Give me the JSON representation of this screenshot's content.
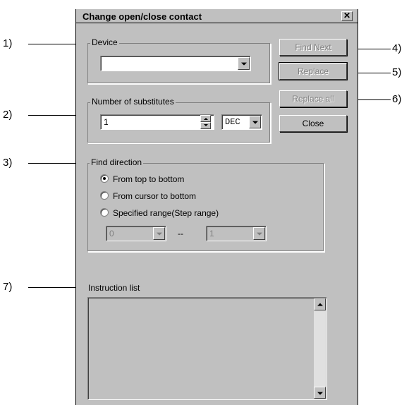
{
  "window": {
    "title": "Change open/close contact",
    "close_glyph": "✕"
  },
  "device": {
    "label": "Device",
    "value": ""
  },
  "substitutes": {
    "label": "Number of substitutes",
    "value": "1",
    "radix": "DEC"
  },
  "find_direction": {
    "label": "Find direction",
    "options": [
      {
        "label": "From top to bottom",
        "selected": true
      },
      {
        "label": "From cursor to bottom",
        "selected": false
      },
      {
        "label": "Specified range(Step range)",
        "selected": false
      }
    ],
    "range_from": "0",
    "range_sep": "--",
    "range_to": "1"
  },
  "instruction_list": {
    "label": "Instruction list"
  },
  "buttons": {
    "find_next": "Find Next",
    "replace": "Replace",
    "replace_all": "Replace all",
    "close": "Close"
  },
  "callouts": {
    "c1": "1)",
    "c2": "2)",
    "c3": "3)",
    "c4": "4)",
    "c5": "5)",
    "c6": "6)",
    "c7": "7)"
  }
}
